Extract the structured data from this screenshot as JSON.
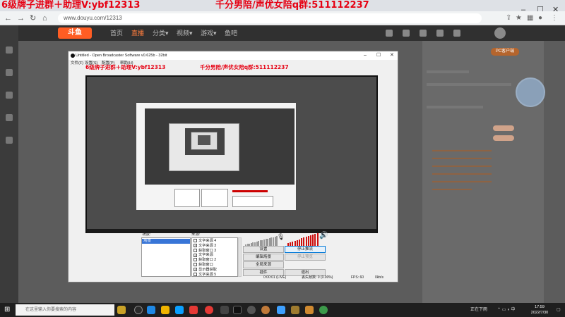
{
  "overlay": {
    "left_text": "6级牌子进群＋助理V:ybf12313",
    "right_text": "千分男陪/声优女陪q群:511112237"
  },
  "browser": {
    "url": "www.douyu.com/12313"
  },
  "site": {
    "logo": "斗鱼",
    "nav": [
      "首页",
      "直播",
      "分类▾",
      "视频▾",
      "游戏▾",
      "鱼吧"
    ],
    "pc_button": "PC客户端"
  },
  "obs": {
    "title": "Untitled - Open Broadcaster Software v0.625b - 32bit",
    "menu": [
      "文件(F)",
      "设置(S)",
      "配置(P)",
      "帮助(H)"
    ],
    "overlay_left": "6级牌子进群＋助理V:ybf12313",
    "overlay_right": "千分男陪/声优女陪q群:511112237",
    "scenes_label": "场景:",
    "sources_label": "来源:",
    "scenes": [
      "场景"
    ],
    "sources": [
      {
        "label": "文字来源 4",
        "checked": false
      },
      {
        "label": "文字来源 3",
        "checked": true
      },
      {
        "label": "获取窗口 3",
        "checked": false
      },
      {
        "label": "文字来源",
        "checked": true
      },
      {
        "label": "获取窗口 2",
        "checked": false
      },
      {
        "label": "获取窗口",
        "checked": false
      },
      {
        "label": "显示器获取",
        "checked": true
      },
      {
        "label": "文字来源 5",
        "checked": false
      }
    ],
    "buttons": {
      "settings": "设置",
      "stop_stream": "停止推流",
      "edit_scene": "编辑场景",
      "stop_preview": "停止预览",
      "global_sources": "全局来源",
      "plugins": "插件",
      "exit": "退出"
    },
    "status": {
      "time": "0:00:01 (LIVE)",
      "dropped": "丢失帧数: 0 (0.00%)",
      "fps": "FPS: 60",
      "bitrate": "0kb/s"
    }
  },
  "taskbar": {
    "search_placeholder": "在这里输入你要搜索的内容",
    "tray_text": "正在下雨",
    "time": "17:59",
    "date": "2022/7/30"
  }
}
